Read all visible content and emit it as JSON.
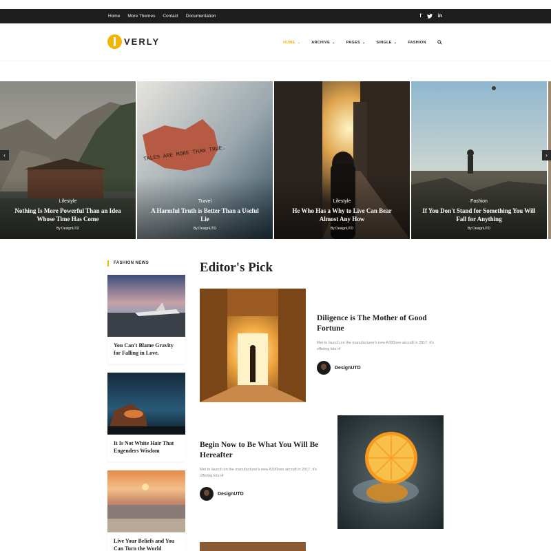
{
  "topbar": {
    "links": [
      "Home",
      "More Themes",
      "Contact",
      "Documentation"
    ],
    "social": [
      "facebook-icon",
      "twitter-icon",
      "linkedin-icon"
    ]
  },
  "logo": {
    "text": "VERLY"
  },
  "nav": {
    "items": [
      {
        "label": "HOME",
        "dropdown": true,
        "active": true
      },
      {
        "label": "ARCHIVE",
        "dropdown": true
      },
      {
        "label": "PAGES",
        "dropdown": true
      },
      {
        "label": "SINGLE",
        "dropdown": true
      },
      {
        "label": "FASHION",
        "dropdown": false
      }
    ],
    "accent": "#f5b400"
  },
  "slider": {
    "slides": [
      {
        "category": "Lifestyle",
        "title": "Nothing Is More Powerful Than an Idea Whose Time Has Come",
        "byline": "By DesignUTD"
      },
      {
        "category": "Travel",
        "title": "A Harmful Truth is Better Than a Useful Lie",
        "byline": "By DesignUTD",
        "note_text": "TALES ARE MORE THAN TRUE."
      },
      {
        "category": "Lifestyle",
        "title": "He Who Has a Why to Live Can Bear Almost Any How",
        "byline": "By DesignUTD"
      },
      {
        "category": "Fashion",
        "title": "If You Don't Stand for Something You Will Fall for Anything",
        "byline": "By DesignUTD"
      }
    ]
  },
  "sidebar": {
    "heading": "FASHION NEWS",
    "posts": [
      {
        "title": "You Can't Blame Gravity for Falling in Love."
      },
      {
        "title": "It Is Not White Hair That Engenders Wisdom"
      },
      {
        "title": "Live Your Beliefs and You Can Turn the World"
      }
    ]
  },
  "main": {
    "heading": "Editor's Pick",
    "posts": [
      {
        "title": "Diligence is The Mother of Good Fortune",
        "excerpt": "Met to launch on the manufacturer's new A330neo aircraft in 2017, it's offering lots of",
        "author": "DesignUTD"
      },
      {
        "title": "Begin Now to Be What You Will Be Hereafter",
        "excerpt": "Met to launch on the manufacturer's new A330neo aircraft in 2017, it's offering lots of",
        "author": "DesignUTD"
      }
    ]
  }
}
